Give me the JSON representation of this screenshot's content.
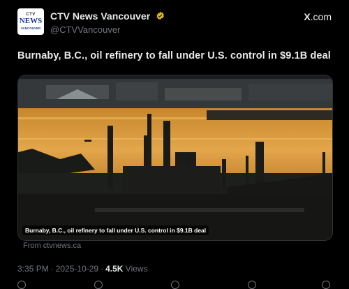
{
  "header": {
    "display_name": "CTV News Vancouver",
    "handle": "@CTVVancouver",
    "source": "X",
    "source_suffix": ".com",
    "avatar": {
      "line1": "CTV",
      "line2": "NEWS",
      "line3": "VANCOUVER"
    },
    "verified_color": "#e2b719"
  },
  "post": {
    "headline": "Burnaby, B.C., oil refinery to fall under U.S. control in $9.1B deal"
  },
  "card": {
    "caption": "Burnaby, B.C., oil refinery to fall under U.S. control in $9.1B deal",
    "from": "From ctvnews.ca"
  },
  "meta": {
    "time": "3:35 PM",
    "date": "2025-10-29",
    "views_count": "4.5K",
    "views_label": "Views"
  },
  "actions": {
    "icons": [
      "reply-icon",
      "repost-icon",
      "like-icon",
      "bookmark-icon",
      "share-icon"
    ]
  }
}
